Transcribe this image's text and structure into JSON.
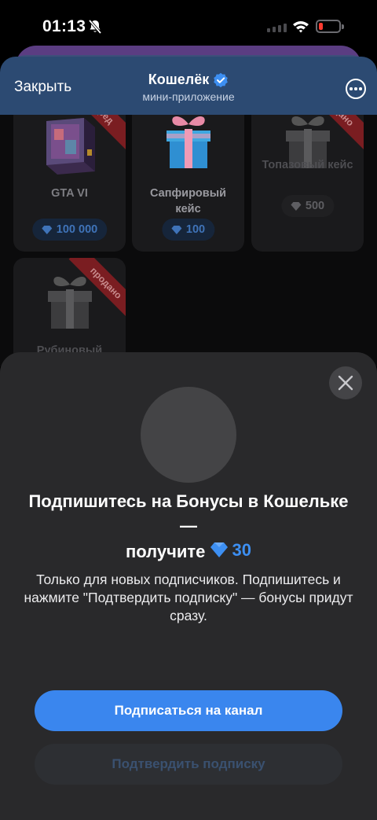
{
  "status_bar": {
    "time": "01:13"
  },
  "header": {
    "close_label": "Закрыть",
    "title": "Кошелёк",
    "subtitle": "мини-приложение"
  },
  "items": [
    {
      "name": "GTA VI",
      "price": "100 000",
      "ribbon": "ред",
      "price_style": "blue"
    },
    {
      "name": "Сапфировый кейс",
      "price": "100",
      "ribbon": "",
      "price_style": "blue"
    },
    {
      "name": "Топазовый кейс",
      "price": "500",
      "ribbon": "дано",
      "price_style": "gray"
    },
    {
      "name": "Рубиновый",
      "price": "",
      "ribbon": "продано",
      "price_style": "gray"
    }
  ],
  "modal": {
    "headline_part1": "Подпишитесь на Бонусы в Кошельке —",
    "headline_part2": "получите",
    "reward_amount": "30",
    "description": "Только для новых подписчиков. Подпишитесь и нажмите \"Подтвердить подписку\" — бонусы придут сразу.",
    "primary_button": "Подписаться на канал",
    "secondary_button": "Подтвердить подписку"
  },
  "colors": {
    "header_bg": "#2c4a72",
    "accent_blue": "#3a86ee",
    "sheet_bg": "#29292b",
    "sold_ribbon": "#7a1d21"
  }
}
